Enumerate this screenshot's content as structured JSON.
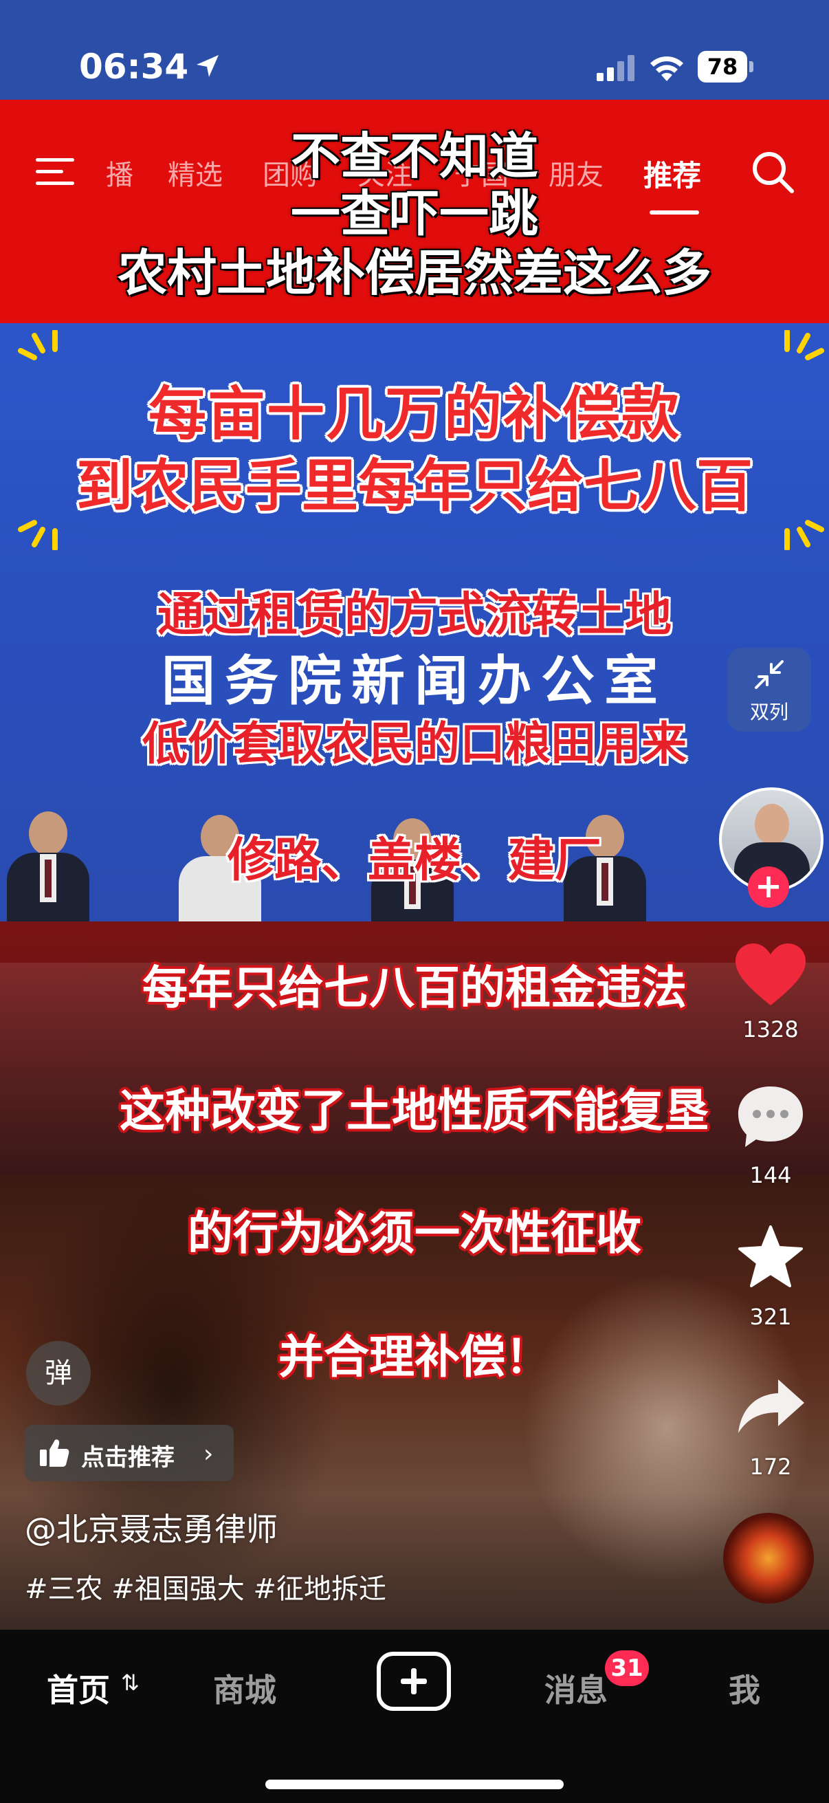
{
  "status_bar": {
    "time": "06:34",
    "battery": "78"
  },
  "top_nav": {
    "tabs": [
      "播",
      "精选",
      "团购",
      "关注",
      "宁国",
      "朋友"
    ],
    "active_tab": "推荐"
  },
  "video": {
    "title_lines": [
      "不查不知道",
      "一查吓一跳",
      "农村土地补偿居然差这么多"
    ],
    "headline_lines": [
      "每亩十几万的补偿款",
      "到农民手里每年只给七八百"
    ],
    "subtitle_red": [
      "通过租赁的方式流转土地",
      "低价套取农民的口粮田用来",
      "修路、盖楼、建厂"
    ],
    "backdrop_text": "国务院新闻办公室",
    "subtitle_white": [
      "每年只给七八百的租金违法",
      "这种改变了土地性质不能复垦",
      "的行为必须一次性征收",
      "并合理补偿！"
    ]
  },
  "right_rail": {
    "dual_column_label": "双列",
    "likes": "1328",
    "comments": "144",
    "favorites": "321",
    "shares": "172"
  },
  "overlay": {
    "danmu_label": "弹",
    "recommend_label": "点击推荐",
    "author": "@北京聂志勇律师",
    "tags": "#三农 #祖国强大 #征地拆迁"
  },
  "tab_bar": {
    "home": "首页",
    "mall": "商城",
    "messages": "消息",
    "messages_badge": "31",
    "me": "我"
  },
  "colors": {
    "banner_red": "#e10c0c",
    "backdrop_blue": "#2c56c8",
    "accent_pink": "#fe2c55",
    "like_red": "#f0283c"
  }
}
